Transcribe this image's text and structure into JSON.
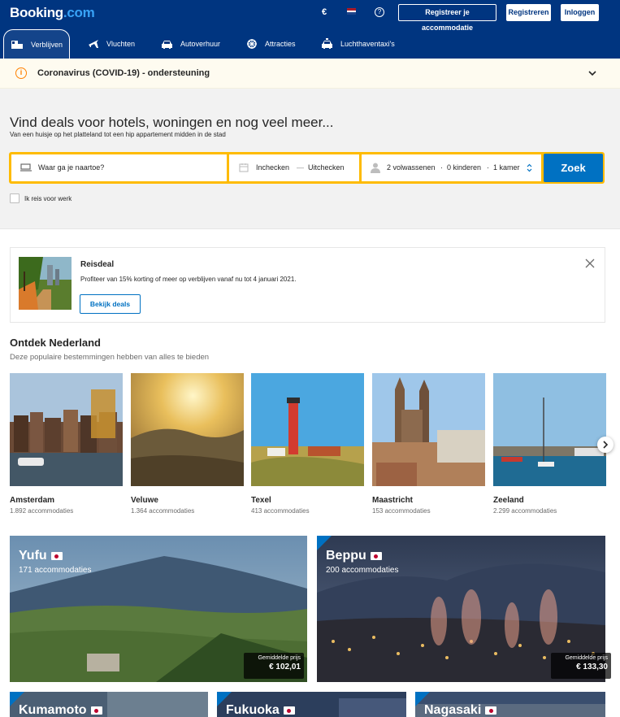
{
  "header": {
    "logo_main": "Booking",
    "logo_suffix": ".com",
    "currency": "€",
    "help_glyph": "?",
    "register_property": "Registreer je accommodatie",
    "register": "Registreren",
    "login": "Inloggen"
  },
  "nav": {
    "items": [
      {
        "label": "Verblijven",
        "icon": "bed-icon",
        "active": true
      },
      {
        "label": "Vluchten",
        "icon": "plane-icon"
      },
      {
        "label": "Autoverhuur",
        "icon": "car-icon"
      },
      {
        "label": "Attracties",
        "icon": "attractions-icon"
      },
      {
        "label": "Luchthaventaxi's",
        "icon": "taxi-icon"
      }
    ]
  },
  "covid": {
    "icon_glyph": "i",
    "text": "Coronavirus (COVID-19) - ondersteuning"
  },
  "search": {
    "title": "Vind deals voor hotels, woningen en nog veel meer...",
    "subtitle": "Van een huisje op het platteland tot een hip appartement midden in de stad",
    "destination_placeholder": "Waar ga je naartoe?",
    "checkin": "Inchecken",
    "dash": "—",
    "checkout": "Uitchecken",
    "adults": "2 volwassenen",
    "sep": "·",
    "children": "0 kinderen",
    "rooms": "1 kamer",
    "button": "Zoek",
    "work_travel": "Ik reis voor werk"
  },
  "deal": {
    "title": "Reisdeal",
    "text": "Profiteer van 15% korting of meer op verblijven vanaf nu tot 4 januari 2021.",
    "button": "Bekijk deals"
  },
  "discover": {
    "title": "Ontdek Nederland",
    "subtitle": "Deze populaire bestemmingen hebben van alles te bieden",
    "destinations": [
      {
        "name": "Amsterdam",
        "count": "1.892 accommodaties"
      },
      {
        "name": "Veluwe",
        "count": "1.364 accommodaties"
      },
      {
        "name": "Texel",
        "count": "413 accommodaties"
      },
      {
        "name": "Maastricht",
        "count": "153 accommodaties"
      },
      {
        "name": "Zeeland",
        "count": "2.299 accommodaties"
      }
    ]
  },
  "featured": [
    {
      "name": "Yufu",
      "count": "171 accommodaties",
      "price_label": "Gemiddelde prijs",
      "price": "€ 102,01"
    },
    {
      "name": "Beppu",
      "count": "200 accommodaties",
      "price_label": "Gemiddelde prijs",
      "price": "€ 133,30"
    }
  ],
  "more": [
    {
      "name": "Kumamoto"
    },
    {
      "name": "Fukuoka"
    },
    {
      "name": "Nagasaki"
    }
  ],
  "colors": {
    "brand": "#003580",
    "accent": "#0071c2",
    "search_border": "#febb02"
  }
}
